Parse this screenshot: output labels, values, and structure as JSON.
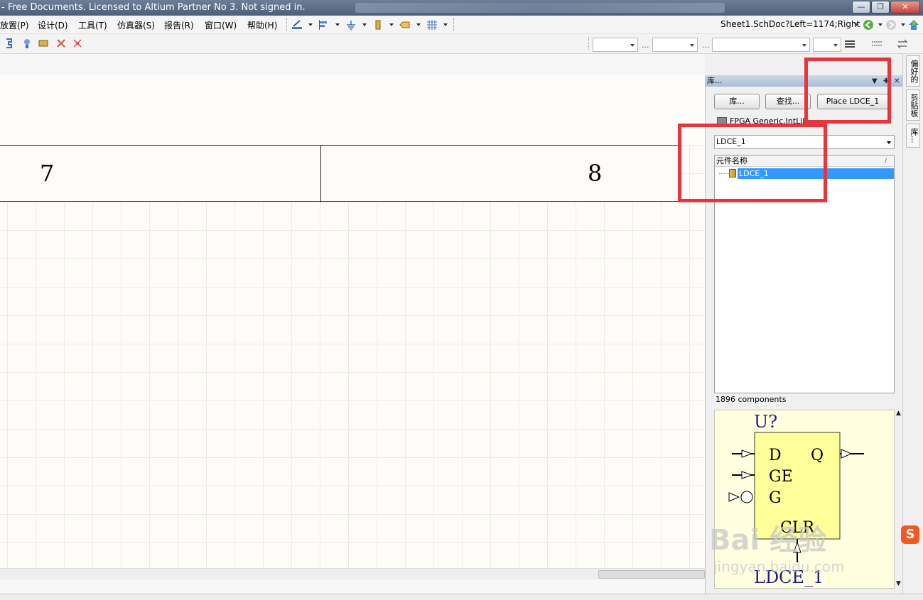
{
  "window": {
    "title": "- Free Documents. Licensed to Altium Partner No 3. Not signed in.",
    "buttons": [
      "—",
      "❐",
      "✕"
    ]
  },
  "menu": {
    "items": [
      "放置(P)",
      "设计(D)",
      "工具(T)",
      "仿真器(S)",
      "报告(R)",
      "窗口(W)",
      "帮助(H)"
    ],
    "document_path": "Sheet1.SchDoc?Left=1174;Right"
  },
  "sheet": {
    "zone_left": "7",
    "zone_right": "8"
  },
  "panel": {
    "title": "库...",
    "buttons": {
      "libraries": "库...",
      "search": "查找...",
      "place": "Place LDCE_1"
    },
    "library_name": "FPGA Generic.IntLib",
    "filter_value": "LDCE_1",
    "list_header": "元件名称",
    "sort_indicator": "/",
    "selected_component": "LDCE_1",
    "component_count": "1896 components",
    "preview": {
      "designator": "U?",
      "pins_left": [
        "D",
        "GE",
        "G"
      ],
      "pin_right": "Q",
      "pin_bottom": "CLR",
      "part_name": "LDCE_1"
    }
  },
  "side_tabs": [
    "偏好的",
    "剪贴板",
    "库..."
  ],
  "watermark": {
    "logo": "Bai 经验",
    "url": "jingyan.baidu.com"
  },
  "colors": {
    "highlight_box": "#e8353b",
    "selection": "#3399ff",
    "preview_bg": "#ffffe0",
    "preview_ink": "#00008b"
  }
}
